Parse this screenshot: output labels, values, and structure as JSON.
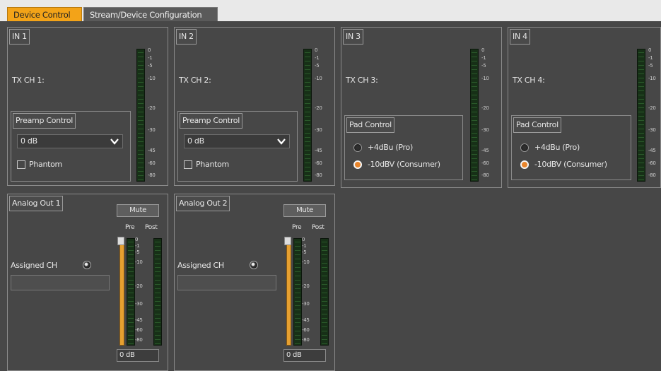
{
  "tabs": [
    {
      "label": "Device Control",
      "active": true
    },
    {
      "label": "Stream/Device Configuration",
      "active": false
    }
  ],
  "colors": {
    "accent": "#f3a318",
    "background": "#484848",
    "meter": "#173017",
    "radio_on": "#e8842a"
  },
  "meter_scale": [
    "0",
    "-1",
    "-5",
    "-10",
    "-20",
    "-30",
    "-45",
    "-60",
    "-80"
  ],
  "inputs": [
    {
      "title": "IN 1",
      "tx_label": "TX CH 1:",
      "control_title": "Preamp Control",
      "gain": "0 dB",
      "phantom_label": "Phantom"
    },
    {
      "title": "IN 2",
      "tx_label": "TX CH 2:",
      "control_title": "Preamp Control",
      "gain": "0 dB",
      "phantom_label": "Phantom"
    },
    {
      "title": "IN 3",
      "tx_label": "TX CH 3:",
      "control_title": "Pad Control",
      "option1": "+4dBu (Pro)",
      "option2": "-10dBV (Consumer)"
    },
    {
      "title": "IN 4",
      "tx_label": "TX CH 4:",
      "control_title": "Pad Control",
      "option1": "+4dBu (Pro)",
      "option2": "-10dBV (Consumer)"
    }
  ],
  "outputs": [
    {
      "title": "Analog Out 1",
      "mute_label": "Mute",
      "pre_label": "Pre",
      "post_label": "Post",
      "assigned_label": "Assigned CH",
      "assigned_value": "",
      "level": "0 dB"
    },
    {
      "title": "Analog Out 2",
      "mute_label": "Mute",
      "pre_label": "Pre",
      "post_label": "Post",
      "assigned_label": "Assigned CH",
      "assigned_value": "",
      "level": "0 dB"
    }
  ]
}
